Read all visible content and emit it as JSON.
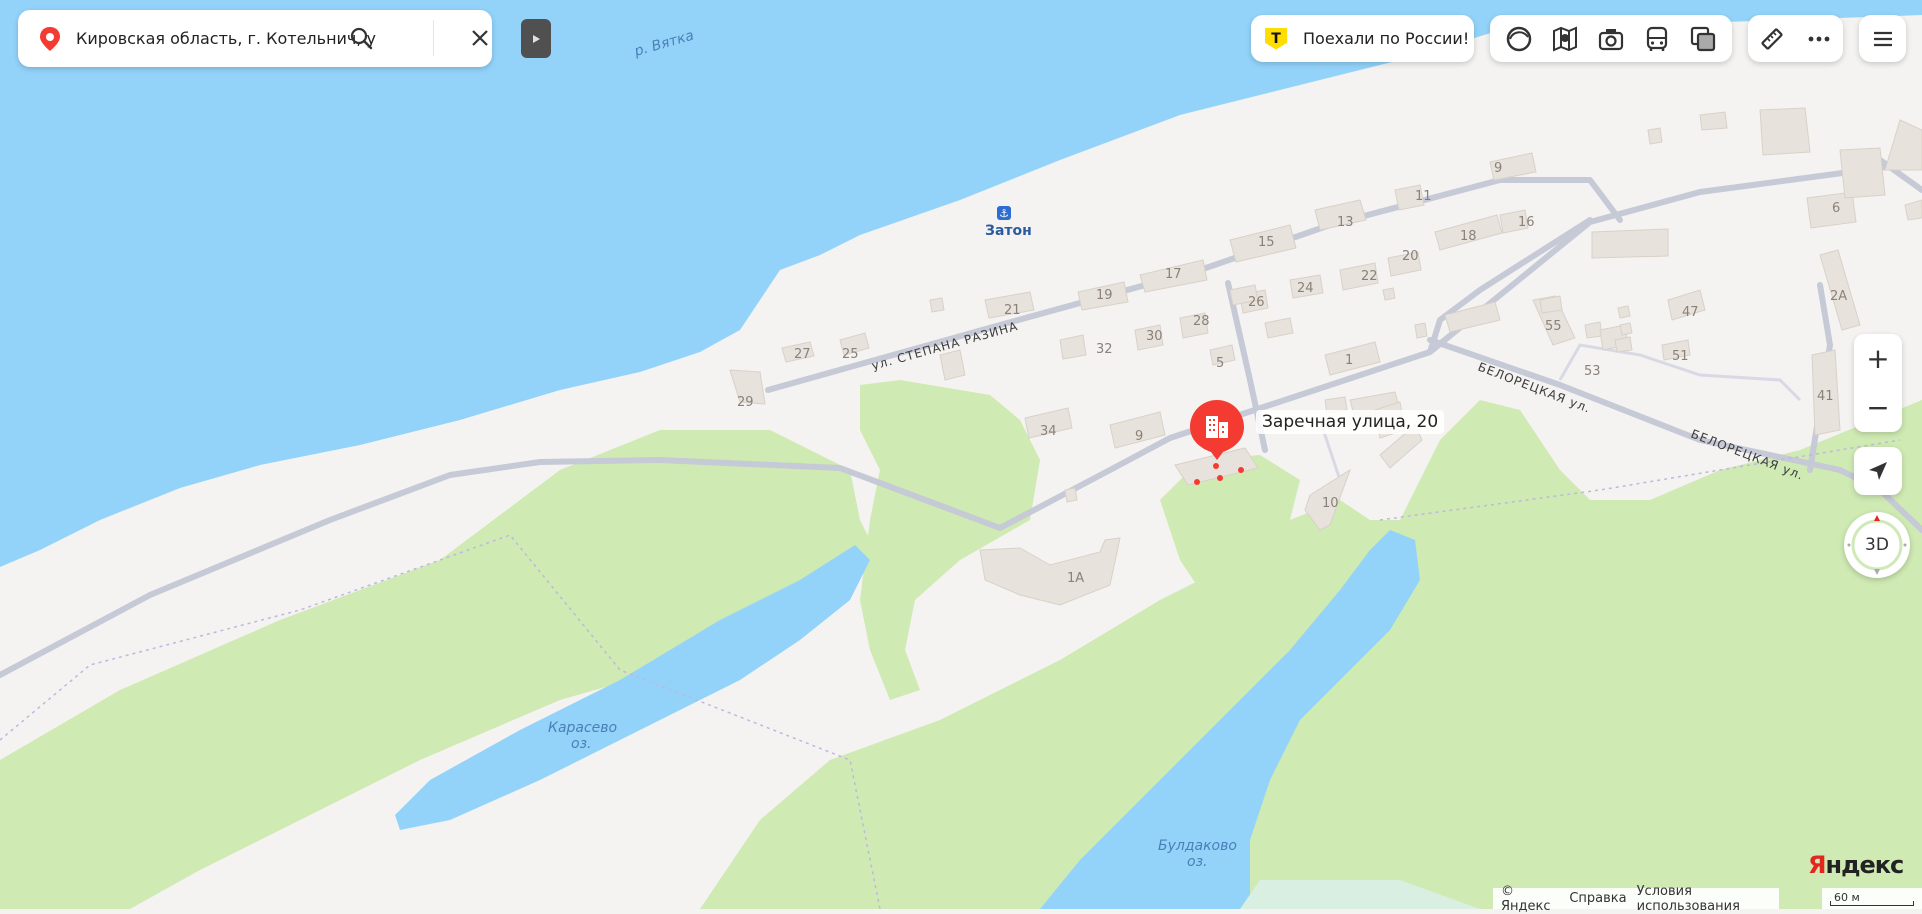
{
  "search": {
    "query": "Кировская область, г. Котельнич, ул.",
    "icons": [
      "location-pin-icon",
      "search-icon",
      "close-icon"
    ]
  },
  "promo": {
    "badge": "Т",
    "label": "Поехали по России!"
  },
  "toolbar": {
    "layers": [
      "panorama-icon",
      "map-layers-icon",
      "photo-icon",
      "transit-icon",
      "layer-switch-icon"
    ],
    "tools": [
      "ruler-icon",
      "more-icon"
    ],
    "menu": "hamburger-menu-icon"
  },
  "controls": {
    "zoom_in": "+",
    "zoom_out": "−",
    "mode_3d": "3D",
    "geolocation": "geolocation-arrow-icon"
  },
  "map": {
    "colors": {
      "water": "#93d3fa",
      "land": "#f4f3f1",
      "park": "#cfeab3",
      "road": "#c6c9d6",
      "building": "#e7e2dc",
      "pin": "#f43b32"
    },
    "water_labels": {
      "river": "р. Вятка",
      "lake1_line1": "Карасево",
      "lake1_line2": "оз.",
      "lake2_line1": "Булдаково",
      "lake2_line2": "оз."
    },
    "poi": {
      "name": "Затон",
      "icon": "anchor-icon"
    },
    "streets": {
      "stepana_razina": "ул. СТЕПАНА РАЗИНА",
      "beloretskaya1": "БЕЛОРЕЦКАЯ ул.",
      "beloretskaya2": "БЕЛОРЕЦКАЯ ул."
    },
    "buildings": [
      "9",
      "11",
      "13",
      "15",
      "17",
      "19",
      "21",
      "25",
      "27",
      "29",
      "32",
      "30",
      "28",
      "26",
      "24",
      "22",
      "20",
      "18",
      "16",
      "6",
      "2А",
      "55",
      "47",
      "51",
      "53",
      "41",
      "1",
      "5",
      "34",
      "9",
      "10",
      "1А"
    ],
    "selected_place": {
      "label": "Заречная улица, 20",
      "icon": "building-icon"
    }
  },
  "footer": {
    "copyright": "© Яндекс",
    "help": "Справка",
    "terms": "Условия использования",
    "scale": "60 м"
  },
  "logo": {
    "first": "Я",
    "rest": "ндекс"
  }
}
